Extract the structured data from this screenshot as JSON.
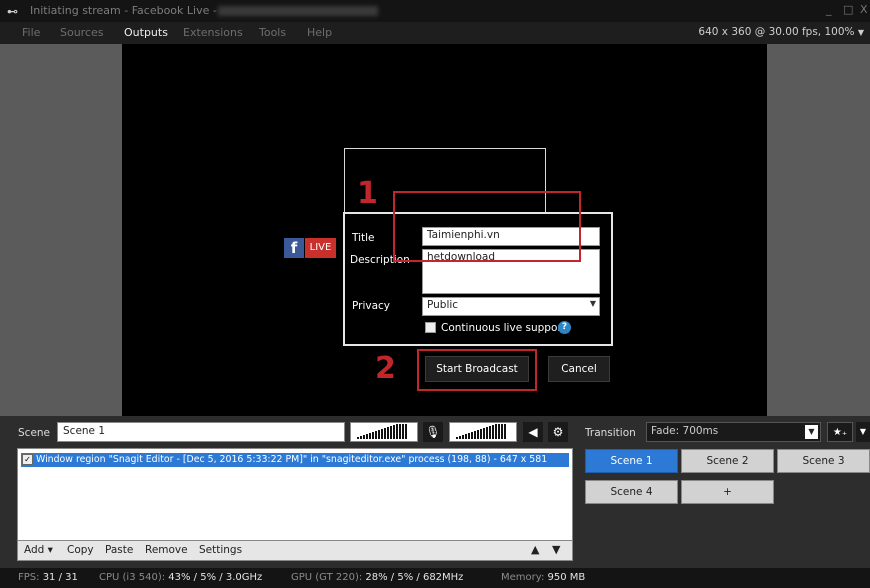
{
  "window": {
    "title": "Initiating stream - Facebook Live -",
    "controls": {
      "minimize": "_",
      "maximize": "□",
      "close": "X"
    }
  },
  "menu": {
    "items": [
      "File",
      "Sources",
      "Outputs",
      "Extensions",
      "Tools",
      "Help"
    ],
    "active": "Outputs",
    "resolution": "640 x 360 @ 30.00 fps, 100%"
  },
  "overlay": {
    "fb_letter": "f",
    "live_badge": "LIVE"
  },
  "dialog": {
    "title_label": "Title",
    "title_value": "Taimienphi.vn",
    "description_label": "Description",
    "description_value": "hetdownload",
    "privacy_label": "Privacy",
    "privacy_value": "Public",
    "continuous_label": "Continuous live support",
    "help_glyph": "?",
    "start_button": "Start Broadcast",
    "cancel_button": "Cancel"
  },
  "annotations": {
    "step1": "1",
    "step2": "2"
  },
  "scene": {
    "label": "Scene",
    "value": "Scene 1"
  },
  "sources": {
    "rows": [
      {
        "checked": true,
        "text": "Window region \"Snagit Editor - [Dec 5, 2016 5:33:22 PM]\" in \"snagiteditor.exe\" process (198, 88) - 647 x 581"
      }
    ],
    "toolbar": {
      "add": "Add ▾",
      "copy": "Copy",
      "paste": "Paste",
      "remove": "Remove",
      "settings": "Settings",
      "up": "▲",
      "down": "▼"
    }
  },
  "transition": {
    "label": "Transition",
    "value": "Fade: 700ms",
    "add_icon": "★₊"
  },
  "scenes": [
    {
      "label": "Scene 1",
      "active": true
    },
    {
      "label": "Scene 2"
    },
    {
      "label": "Scene 3"
    },
    {
      "label": "Scene 4"
    },
    {
      "label": "+"
    }
  ],
  "status": {
    "fps_label": "FPS:",
    "fps_value": "31 / 31",
    "cpu_label": "CPU (i3 540):",
    "cpu_value": "43% / 5% / 3.0GHz",
    "gpu_label": "GPU (GT 220):",
    "gpu_value": "28% / 5% / 682MHz",
    "mem_label": "Memory:",
    "mem_value": "950 MB"
  },
  "colors": {
    "accent": "#2c7ad6",
    "annotation_red": "#c0272d",
    "facebook_blue": "#3b5998",
    "live_red": "#c9302c"
  }
}
